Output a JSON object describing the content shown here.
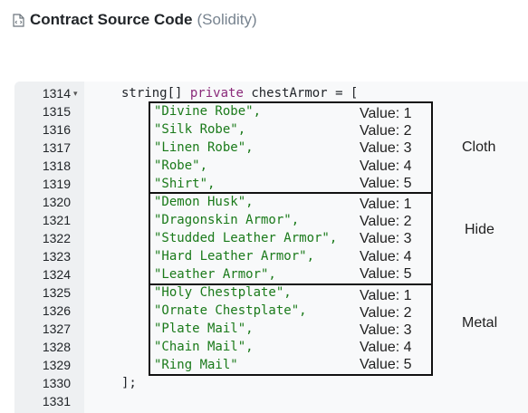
{
  "header": {
    "title": "Contract Source Code",
    "subtitle": "(Solidity)",
    "icon": "code-file-icon"
  },
  "colors": {
    "string": "#1a7a1a",
    "keyword": "#8a2a7a",
    "gutter": "#eef0f2",
    "editor_bg": "#f8f9fa"
  },
  "editor": {
    "line_numbers": [
      "1314",
      "1315",
      "1316",
      "1317",
      "1318",
      "1319",
      "1320",
      "1321",
      "1322",
      "1323",
      "1324",
      "1325",
      "1326",
      "1327",
      "1328",
      "1329",
      "1330",
      "1331"
    ],
    "declaration": {
      "type": "string[]",
      "modifier": "private",
      "name": "chestArmor",
      "assign": "= ["
    },
    "items": [
      "\"Divine Robe\",",
      "\"Silk Robe\",",
      "\"Linen Robe\",",
      "\"Robe\",",
      "\"Shirt\",",
      "\"Demon Husk\",",
      "\"Dragonskin Armor\",",
      "\"Studded Leather Armor\",",
      "\"Hard Leather Armor\",",
      "\"Leather Armor\",",
      "\"Holy Chestplate\",",
      "\"Ornate Chestplate\",",
      "\"Plate Mail\",",
      "\"Chain Mail\",",
      "\"Ring Mail\""
    ],
    "close": "];"
  },
  "annotations": {
    "values": [
      "Value: 1",
      "Value: 2",
      "Value: 3",
      "Value: 4",
      "Value: 5",
      "Value: 1",
      "Value: 2",
      "Value: 3",
      "Value: 4",
      "Value: 5",
      "Value: 1",
      "Value: 2",
      "Value: 3",
      "Value: 4",
      "Value: 5"
    ],
    "groups": [
      "Cloth",
      "Hide",
      "Metal"
    ]
  }
}
